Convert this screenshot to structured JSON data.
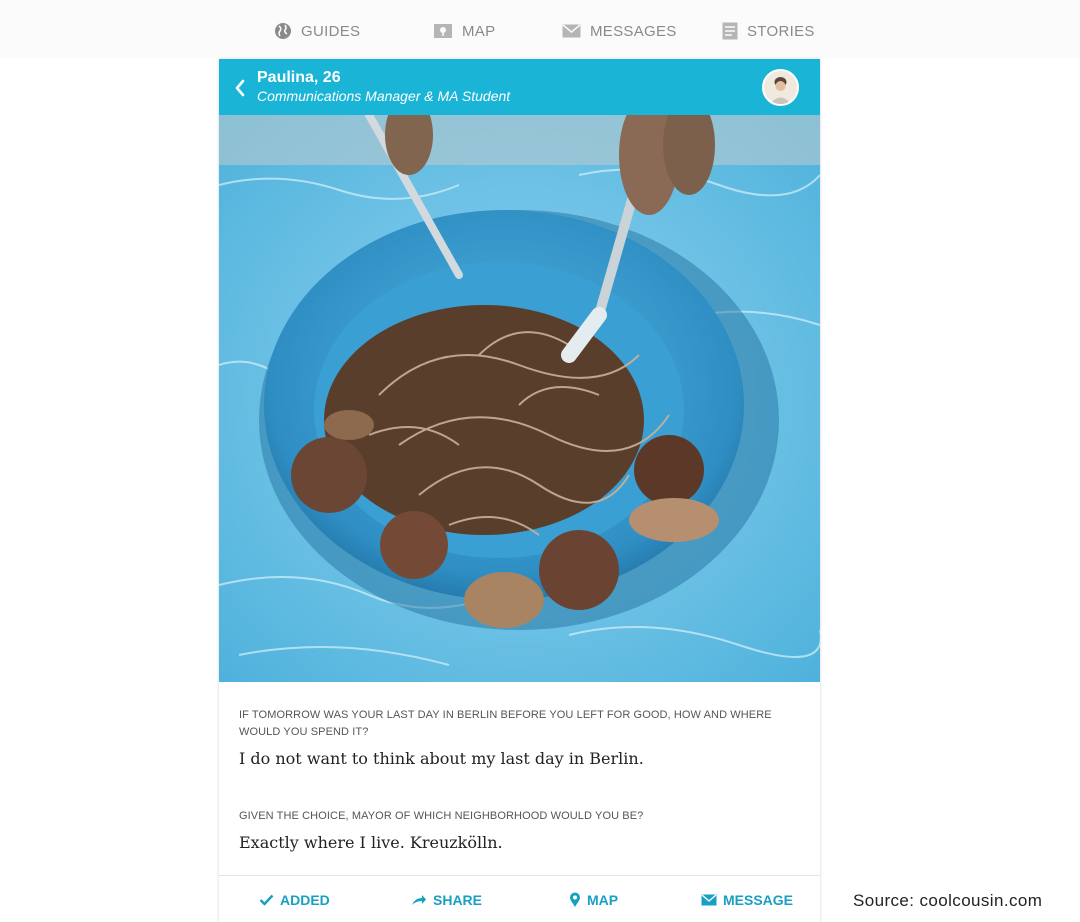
{
  "nav": {
    "items": [
      {
        "label": "GUIDES",
        "icon": "globe-icon"
      },
      {
        "label": "MAP",
        "icon": "map-icon"
      },
      {
        "label": "MESSAGES",
        "icon": "envelope-icon"
      },
      {
        "label": "STORIES",
        "icon": "document-icon"
      }
    ]
  },
  "header": {
    "name": "Paulina, 26",
    "role": "Communications Manager & MA Student"
  },
  "photo": {
    "description_icon": "food-photo"
  },
  "qa": [
    {
      "question": "IF TOMORROW WAS YOUR LAST DAY IN BERLIN BEFORE YOU LEFT FOR GOOD, HOW AND WHERE WOULD YOU SPEND IT?",
      "answer": "I do not want to think about my last day in Berlin."
    },
    {
      "question": "GIVEN THE CHOICE, MAYOR OF WHICH NEIGHBORHOOD WOULD YOU BE?",
      "answer": "Exactly where I live. Kreuzkölln."
    }
  ],
  "actions": {
    "added": "ADDED",
    "share": "SHARE",
    "map": "MAP",
    "message": "MESSAGE"
  },
  "source": "Source: coolcousin.com",
  "colors": {
    "header_bg": "#1ab5d6",
    "action_text": "#1a9fc4",
    "nav_text": "#8a8a8a"
  }
}
